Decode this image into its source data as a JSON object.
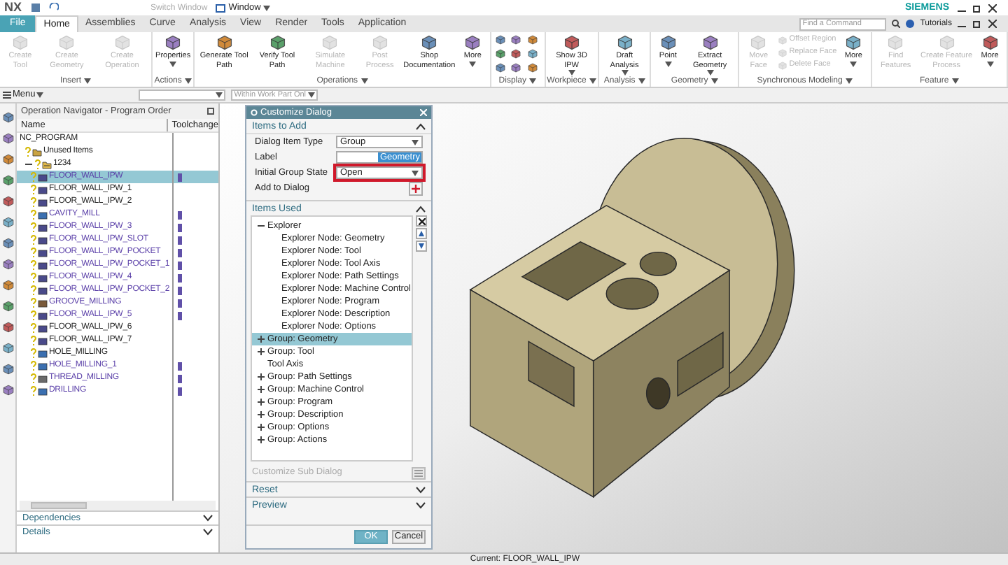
{
  "title_bar": {
    "app": "NX",
    "switch_window": "Switch Window",
    "window_menu": "Window",
    "brand": "SIEMENS"
  },
  "menu_tabs": [
    {
      "label": "File",
      "kind": "file",
      "selected": false
    },
    {
      "label": "Home",
      "kind": "tab",
      "selected": true
    },
    {
      "label": "Assemblies",
      "kind": "tab",
      "selected": false
    },
    {
      "label": "Curve",
      "kind": "tab",
      "selected": false
    },
    {
      "label": "Analysis",
      "kind": "tab",
      "selected": false
    },
    {
      "label": "View",
      "kind": "tab",
      "selected": false
    },
    {
      "label": "Render",
      "kind": "tab",
      "selected": false
    },
    {
      "label": "Tools",
      "kind": "tab",
      "selected": false
    },
    {
      "label": "Application",
      "kind": "tab",
      "selected": false
    }
  ],
  "search": {
    "placeholder": "Find a Command"
  },
  "tutorials": "Tutorials",
  "ribbon_groups": [
    {
      "title": "Insert",
      "kind": "buttons",
      "buttons": [
        {
          "label": "Create Tool",
          "kind": "large",
          "disabled": true,
          "dropdown": false
        },
        {
          "label": "Create Geometry",
          "kind": "large",
          "disabled": true,
          "dropdown": false
        },
        {
          "label": "Create Operation",
          "kind": "large",
          "disabled": true,
          "dropdown": false
        }
      ]
    },
    {
      "title": "Actions",
      "kind": "buttons",
      "buttons": [
        {
          "label": "Properties",
          "kind": "large",
          "disabled": false,
          "dropdown": true
        }
      ]
    },
    {
      "title": "Operations",
      "kind": "buttons",
      "buttons": [
        {
          "label": "Generate Tool Path",
          "kind": "large",
          "disabled": false,
          "dropdown": false
        },
        {
          "label": "Verify Tool Path",
          "kind": "large",
          "disabled": false,
          "dropdown": false
        },
        {
          "label": "Simulate Machine",
          "kind": "large",
          "disabled": true,
          "dropdown": false
        },
        {
          "label": "Post Process",
          "kind": "large",
          "disabled": true,
          "dropdown": false
        },
        {
          "label": "Shop Documentation",
          "kind": "large",
          "disabled": false,
          "dropdown": false
        },
        {
          "label": "More",
          "kind": "large",
          "disabled": false,
          "dropdown": true
        }
      ]
    },
    {
      "title": "Display",
      "kind": "icons"
    },
    {
      "title": "Workpiece",
      "kind": "buttons",
      "buttons": [
        {
          "label": "Show 3D IPW",
          "kind": "large",
          "disabled": false,
          "dropdown": true
        }
      ]
    },
    {
      "title": "Analysis",
      "kind": "buttons",
      "buttons": [
        {
          "label": "Draft Analysis",
          "kind": "large",
          "disabled": false,
          "dropdown": true
        }
      ]
    },
    {
      "title": "Geometry",
      "kind": "buttons",
      "buttons": [
        {
          "label": "Point",
          "kind": "large",
          "disabled": false,
          "dropdown": true
        },
        {
          "label": "Extract Geometry",
          "kind": "large",
          "disabled": false,
          "dropdown": true
        }
      ]
    },
    {
      "title": "Synchronous Modeling",
      "kind": "buttons",
      "buttons": [
        {
          "label": "Move Face",
          "kind": "large",
          "disabled": true,
          "dropdown": false
        },
        {
          "label": "Offset Region",
          "kind": "small",
          "disabled": true,
          "dropdown": false
        },
        {
          "label": "Replace Face",
          "kind": "small",
          "disabled": true,
          "dropdown": false
        },
        {
          "label": "Delete Face",
          "kind": "small",
          "disabled": true,
          "dropdown": false
        },
        {
          "label": "More",
          "kind": "large",
          "disabled": false,
          "dropdown": true
        }
      ]
    },
    {
      "title": "Feature",
      "kind": "buttons",
      "buttons": [
        {
          "label": "Find Features",
          "kind": "large",
          "disabled": true,
          "dropdown": false
        },
        {
          "label": "Create Feature Process",
          "kind": "large",
          "disabled": true,
          "dropdown": false
        },
        {
          "label": "More",
          "kind": "large",
          "disabled": false,
          "dropdown": true
        }
      ]
    }
  ],
  "toolbar": {
    "menu": "Menu",
    "filter_value": "Within Work Part Onl"
  },
  "navigator": {
    "title": "Operation Navigator - Program Order",
    "columns": [
      "Name",
      "Toolchange"
    ],
    "tree": [
      {
        "name": "NC_PROGRAM",
        "selected": false,
        "children": [
          {
            "name": "Unused Items",
            "kind": "folder",
            "selected": false
          },
          {
            "name": "1234",
            "kind": "program",
            "selected": false,
            "expanded": true,
            "children": [
              {
                "name": "FLOOR_WALL_IPW",
                "kind": "mill",
                "toolchange": true,
                "selected": true
              },
              {
                "name": "FLOOR_WALL_IPW_1",
                "kind": "mill",
                "toolchange": false,
                "selected": false
              },
              {
                "name": "FLOOR_WALL_IPW_2",
                "kind": "mill",
                "toolchange": false,
                "selected": false
              },
              {
                "name": "CAVITY_MILL",
                "kind": "cavity",
                "toolchange": true,
                "selected": false
              },
              {
                "name": "FLOOR_WALL_IPW_3",
                "kind": "mill",
                "toolchange": true,
                "selected": false
              },
              {
                "name": "FLOOR_WALL_IPW_SLOT",
                "kind": "mill",
                "toolchange": true,
                "selected": false
              },
              {
                "name": "FLOOR_WALL_IPW_POCKET",
                "kind": "mill",
                "toolchange": true,
                "selected": false
              },
              {
                "name": "FLOOR_WALL_IPW_POCKET_1",
                "kind": "mill",
                "toolchange": true,
                "selected": false
              },
              {
                "name": "FLOOR_WALL_IPW_4",
                "kind": "mill",
                "toolchange": true,
                "selected": false
              },
              {
                "name": "FLOOR_WALL_IPW_POCKET_2",
                "kind": "mill",
                "toolchange": true,
                "selected": false
              },
              {
                "name": "GROOVE_MILLING",
                "kind": "groove",
                "toolchange": true,
                "selected": false
              },
              {
                "name": "FLOOR_WALL_IPW_5",
                "kind": "mill",
                "toolchange": true,
                "selected": false
              },
              {
                "name": "FLOOR_WALL_IPW_6",
                "kind": "mill",
                "toolchange": false,
                "selected": false
              },
              {
                "name": "FLOOR_WALL_IPW_7",
                "kind": "mill",
                "toolchange": false,
                "selected": false
              },
              {
                "name": "HOLE_MILLING",
                "kind": "hole",
                "toolchange": false,
                "selected": false
              },
              {
                "name": "HOLE_MILLING_1",
                "kind": "hole",
                "toolchange": true,
                "selected": false
              },
              {
                "name": "THREAD_MILLING",
                "kind": "thread",
                "toolchange": true,
                "selected": false
              },
              {
                "name": "DRILLING",
                "kind": "drill",
                "toolchange": true,
                "selected": false
              }
            ]
          }
        ]
      }
    ],
    "sections": [
      {
        "label": "Dependencies",
        "expanded": false
      },
      {
        "label": "Details",
        "expanded": false
      }
    ]
  },
  "dialog": {
    "title": "Customize Dialog",
    "items_to_add": {
      "title": "Items to Add",
      "expanded": true,
      "fields": [
        {
          "label": "Dialog Item Type",
          "kind": "dropdown",
          "value": "Group"
        },
        {
          "label": "Label",
          "kind": "text",
          "value": "Geometry",
          "selected": true
        },
        {
          "label": "Initial Group State",
          "kind": "dropdown",
          "value": "Open",
          "highlighted": true
        },
        {
          "label": "Add to Dialog",
          "kind": "button"
        }
      ]
    },
    "items_used": {
      "title": "Items Used",
      "expanded": true,
      "tree": [
        {
          "label": "Explorer",
          "expanded": true,
          "selected": false,
          "children": [
            {
              "label": "Explorer Node: Geometry",
              "selected": false
            },
            {
              "label": "Explorer Node: Tool",
              "selected": false
            },
            {
              "label": "Explorer Node: Tool Axis",
              "selected": false
            },
            {
              "label": "Explorer Node: Path Settings",
              "selected": false
            },
            {
              "label": "Explorer Node: Machine Control",
              "selected": false
            },
            {
              "label": "Explorer Node: Program",
              "selected": false
            },
            {
              "label": "Explorer Node: Description",
              "selected": false
            },
            {
              "label": "Explorer Node: Options",
              "selected": false
            }
          ]
        },
        {
          "label": "Group: Geometry",
          "expanded": false,
          "selected": true
        },
        {
          "label": "Group: Tool",
          "expanded": false,
          "selected": false
        },
        {
          "label": "Tool Axis",
          "selected": false
        },
        {
          "label": "Group: Path Settings",
          "expanded": false,
          "selected": false
        },
        {
          "label": "Group: Machine Control",
          "expanded": false,
          "selected": false
        },
        {
          "label": "Group: Program",
          "expanded": false,
          "selected": false
        },
        {
          "label": "Group: Description",
          "expanded": false,
          "selected": false
        },
        {
          "label": "Group: Options",
          "expanded": false,
          "selected": false
        },
        {
          "label": "Group: Actions",
          "expanded": false,
          "selected": false
        }
      ]
    },
    "sub_dialog": {
      "label": "Customize Sub Dialog",
      "disabled": true
    },
    "collapsed_sections": [
      {
        "label": "Reset",
        "expanded": false
      },
      {
        "label": "Preview",
        "expanded": false
      }
    ],
    "buttons": [
      {
        "label": "OK",
        "kind": "primary"
      },
      {
        "label": "Cancel",
        "kind": "secondary"
      }
    ]
  },
  "status_bar": {
    "text": "Current: FLOOR_WALL_IPW"
  }
}
